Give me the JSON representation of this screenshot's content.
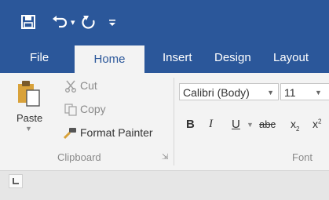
{
  "quick_access": {
    "save_icon": "save-icon",
    "undo_icon": "undo-icon",
    "undo_dropdown_icon": "chevron-down-icon",
    "redo_icon": "redo-icon",
    "customize_icon": "customize-qat-icon"
  },
  "tabs": [
    {
      "label": "File",
      "active": false
    },
    {
      "label": "Home",
      "active": true
    },
    {
      "label": "Insert",
      "active": false
    },
    {
      "label": "Design",
      "active": false
    },
    {
      "label": "Layout",
      "active": false
    }
  ],
  "clipboard": {
    "paste_label": "Paste",
    "cut_label": "Cut",
    "copy_label": "Copy",
    "format_painter_label": "Format Painter",
    "group_label": "Clipboard",
    "launcher_icon": "dialog-launcher-icon"
  },
  "font": {
    "font_name": "Calibri (Body)",
    "font_size": "11",
    "bold": "B",
    "italic": "I",
    "underline": "U",
    "strikethrough": "abc",
    "subscript": "x",
    "subscript_mark": "2",
    "superscript": "x",
    "superscript_mark": "2",
    "group_label": "Font"
  },
  "ruler": {
    "tab_selector_icon": "tab-stop-selector-icon"
  },
  "colors": {
    "accent": "#2b579a",
    "ribbon": "#f3f3f3",
    "background": "#e6e6e6"
  }
}
